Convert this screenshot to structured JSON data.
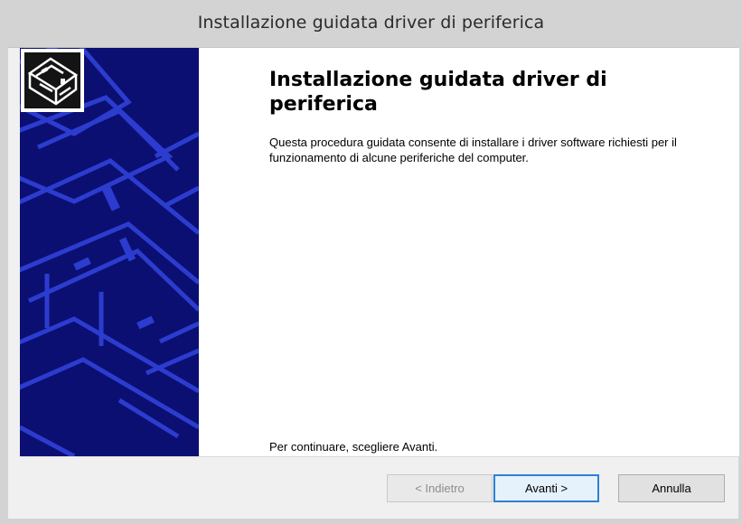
{
  "window": {
    "title": "Installazione guidata driver di periferica"
  },
  "main": {
    "heading": "Installazione guidata driver di periferica",
    "description": "Questa procedura guidata consente di installare i driver software richiesti per il funzionamento di alcune periferiche del computer.",
    "continue_text": "Per continuare, scegliere Avanti."
  },
  "buttons": {
    "back_label": "< Indietro",
    "next_label": "Avanti >",
    "cancel_label": "Annulla"
  },
  "icons": {
    "wizard": "hardware-wizard-icon"
  },
  "colors": {
    "banner": "#0b0f72",
    "banner_lines": "#2c3ccf",
    "titlebar": "#d3d3d3",
    "default_button_border": "#2e7fd6"
  }
}
